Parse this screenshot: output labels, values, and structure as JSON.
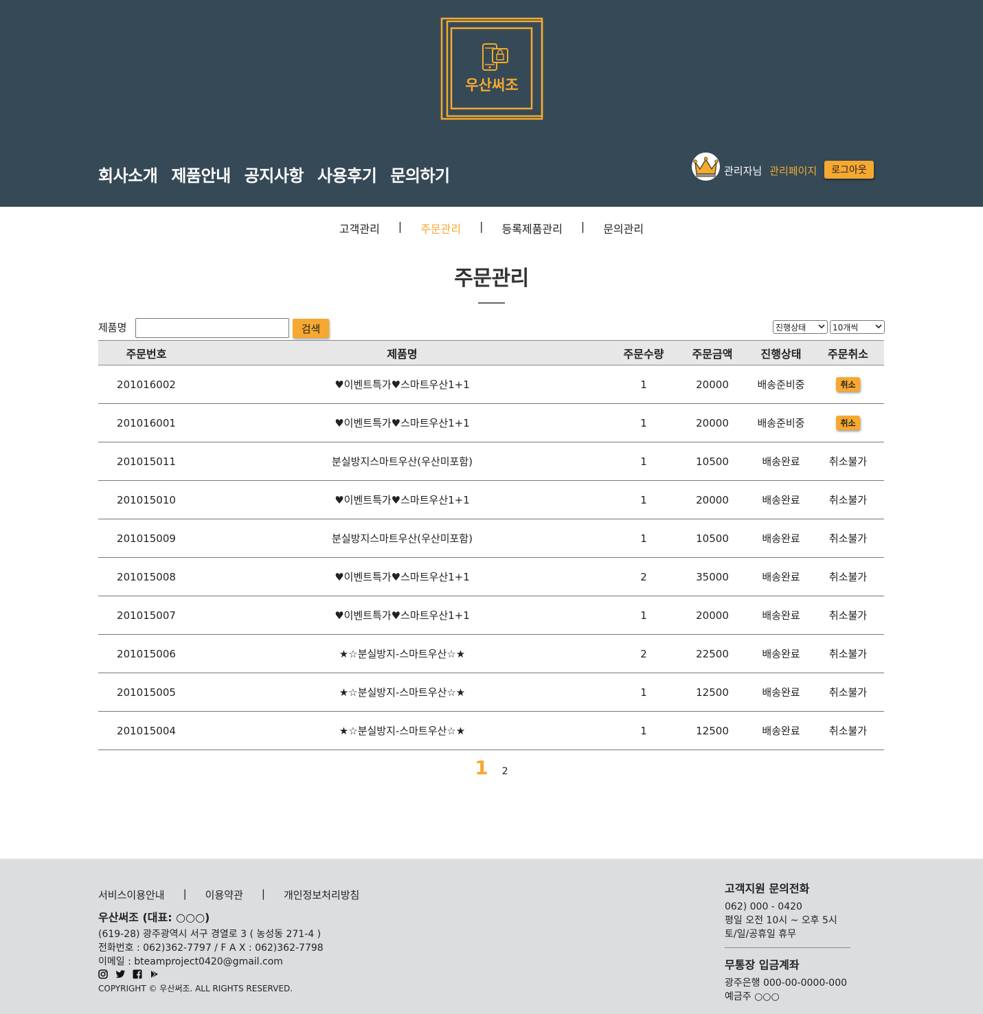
{
  "header": {
    "logo_text": "우산써조",
    "nav": [
      "회사소개",
      "제품안내",
      "공지사항",
      "사용후기",
      "문의하기"
    ],
    "user_name": "관리자님",
    "admin_link": "관리페이지",
    "logout": "로그아웃"
  },
  "sub_nav": {
    "items": [
      "고객관리",
      "주문관리",
      "등록제품관리",
      "문의관리"
    ],
    "separator": "|",
    "active": "주문관리"
  },
  "page": {
    "title": "주문관리"
  },
  "search": {
    "label": "제품명",
    "value": "",
    "button": "검색"
  },
  "filters": {
    "status_selected": "진행상태",
    "count_selected": "10개씩"
  },
  "table": {
    "columns": [
      "주문번호",
      "제품명",
      "주문수량",
      "주문금액",
      "진행상태",
      "주문취소"
    ],
    "rows": [
      {
        "order_no": "201016002",
        "product": "♥이벤트특가♥스마트우산1+1",
        "qty": "1",
        "amount": "20000",
        "status": "배송준비중",
        "cancel": "취소",
        "cancelable": true
      },
      {
        "order_no": "201016001",
        "product": "♥이벤트특가♥스마트우산1+1",
        "qty": "1",
        "amount": "20000",
        "status": "배송준비중",
        "cancel": "취소",
        "cancelable": true
      },
      {
        "order_no": "201015011",
        "product": "분실방지스마트우산(우산미포함)",
        "qty": "1",
        "amount": "10500",
        "status": "배송완료",
        "cancel": "취소불가",
        "cancelable": false
      },
      {
        "order_no": "201015010",
        "product": "♥이벤트특가♥스마트우산1+1",
        "qty": "1",
        "amount": "20000",
        "status": "배송완료",
        "cancel": "취소불가",
        "cancelable": false
      },
      {
        "order_no": "201015009",
        "product": "분실방지스마트우산(우산미포함)",
        "qty": "1",
        "amount": "10500",
        "status": "배송완료",
        "cancel": "취소불가",
        "cancelable": false
      },
      {
        "order_no": "201015008",
        "product": "♥이벤트특가♥스마트우산1+1",
        "qty": "2",
        "amount": "35000",
        "status": "배송완료",
        "cancel": "취소불가",
        "cancelable": false
      },
      {
        "order_no": "201015007",
        "product": "♥이벤트특가♥스마트우산1+1",
        "qty": "1",
        "amount": "20000",
        "status": "배송완료",
        "cancel": "취소불가",
        "cancelable": false
      },
      {
        "order_no": "201015006",
        "product": "★☆분실방지-스마트우산☆★",
        "qty": "2",
        "amount": "22500",
        "status": "배송완료",
        "cancel": "취소불가",
        "cancelable": false
      },
      {
        "order_no": "201015005",
        "product": "★☆분실방지-스마트우산☆★",
        "qty": "1",
        "amount": "12500",
        "status": "배송완료",
        "cancel": "취소불가",
        "cancelable": false
      },
      {
        "order_no": "201015004",
        "product": "★☆분실방지-스마트우산☆★",
        "qty": "1",
        "amount": "12500",
        "status": "배송완료",
        "cancel": "취소불가",
        "cancelable": false
      }
    ]
  },
  "pagination": {
    "pages": [
      "1",
      "2"
    ],
    "current": "1"
  },
  "footer": {
    "links": [
      "서비스이용안내",
      "이용약관",
      "개인정보처리방침"
    ],
    "separator": "|",
    "company": "우산써조 (대표: ○○○)",
    "address": "(619-28) 광주광역시 서구 경열로 3 ( 농성동 271-4 )",
    "phone_fax": "전화번호 : 062)362-7797 / F A X : 062)362-7798",
    "email": "이메일 : bteamproject0420@gmail.com",
    "copyright": "COPYRIGHT © 우산써조. ALL RIGHTS RESERVED.",
    "sns_icons": [
      "instagram-icon",
      "twitter-icon",
      "facebook-icon",
      "google-play-icon"
    ],
    "support_title": "고객지원 문의전화",
    "support_phone": "062) 000 - 0420",
    "support_hours": "평일 오전 10시 ~ 오후 5시",
    "support_closed": "토/일/공휴일 휴무",
    "bank_title": "무통장 입금계좌",
    "bank_account": "광주은행 000-00-0000-000",
    "bank_holder": "예금주 ○○○"
  },
  "colors": {
    "header_bg": "#364957",
    "accent": "#f6a830",
    "footer_bg": "#dcdddf"
  }
}
